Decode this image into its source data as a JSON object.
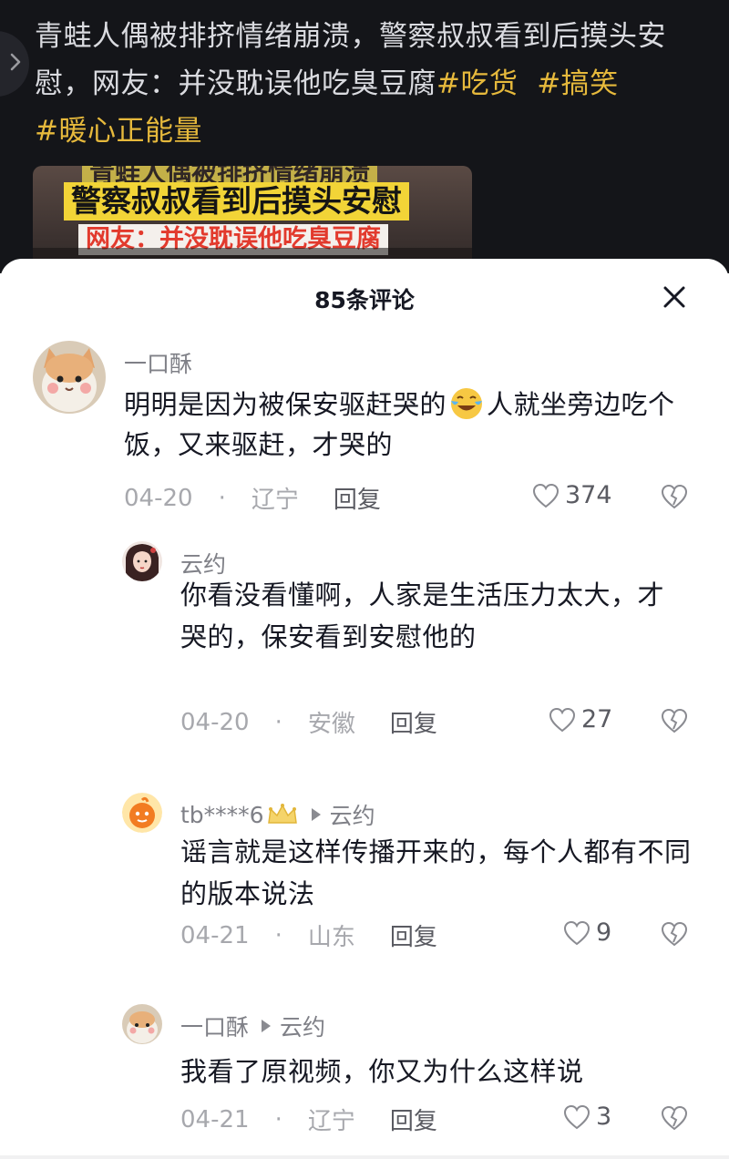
{
  "video": {
    "caption_text": "青蛙人偶被排挤情绪崩溃，警察叔叔看到后摸头安慰，网友：并没耽误他吃臭豆腐",
    "hashtags": [
      "#吃货",
      "#搞笑",
      "#暖心正能量"
    ],
    "thumbnail_lines": [
      "青蛙人偶被排挤情绪崩溃",
      "警察叔叔看到后摸头安慰",
      "网友：并没耽误他吃臭豆腐"
    ]
  },
  "comments_panel": {
    "title": "85条评论"
  },
  "comments": [
    {
      "author": "一口酥",
      "reply_to": "",
      "content_before_emoji": "明明是因为被保安驱赶哭的",
      "content_after_emoji": "人就坐旁边吃个饭，又来驱赶，才哭的",
      "date": "04-20",
      "separator": "·",
      "location": "辽宁",
      "reply_label": "回复",
      "likes": "374"
    },
    {
      "author": "云约",
      "reply_to": "",
      "content": "你看没看懂啊，人家是生活压力太大，才哭的，保安看到安慰他的",
      "date": "04-20",
      "separator": "·",
      "location": "安徽",
      "reply_label": "回复",
      "likes": "27"
    },
    {
      "author": "tb****6",
      "reply_to": "云约",
      "content": "谣言就是这样传播开来的，每个人都有不同的版本说法",
      "date": "04-21",
      "separator": "·",
      "location": "山东",
      "reply_label": "回复",
      "likes": "9"
    },
    {
      "author": "一口酥",
      "reply_to": "云约",
      "content": "我看了原视频，你又为什么这样说",
      "date": "04-21",
      "separator": "·",
      "location": "辽宁",
      "reply_label": "回复",
      "likes": "3"
    }
  ],
  "icons": {
    "collapse": "chevron-right-icon",
    "close": "close-icon",
    "like": "heart-outline-icon",
    "dislike": "broken-heart-icon",
    "reply_arrow": "triangle-right-icon",
    "badge": "crown-icon",
    "emoji": "crying-laughing-emoji"
  },
  "colors": {
    "hashtag": "#e6b93c",
    "video_bg": "#141519",
    "text_primary": "#161823",
    "text_secondary": "#a7a8ad"
  }
}
